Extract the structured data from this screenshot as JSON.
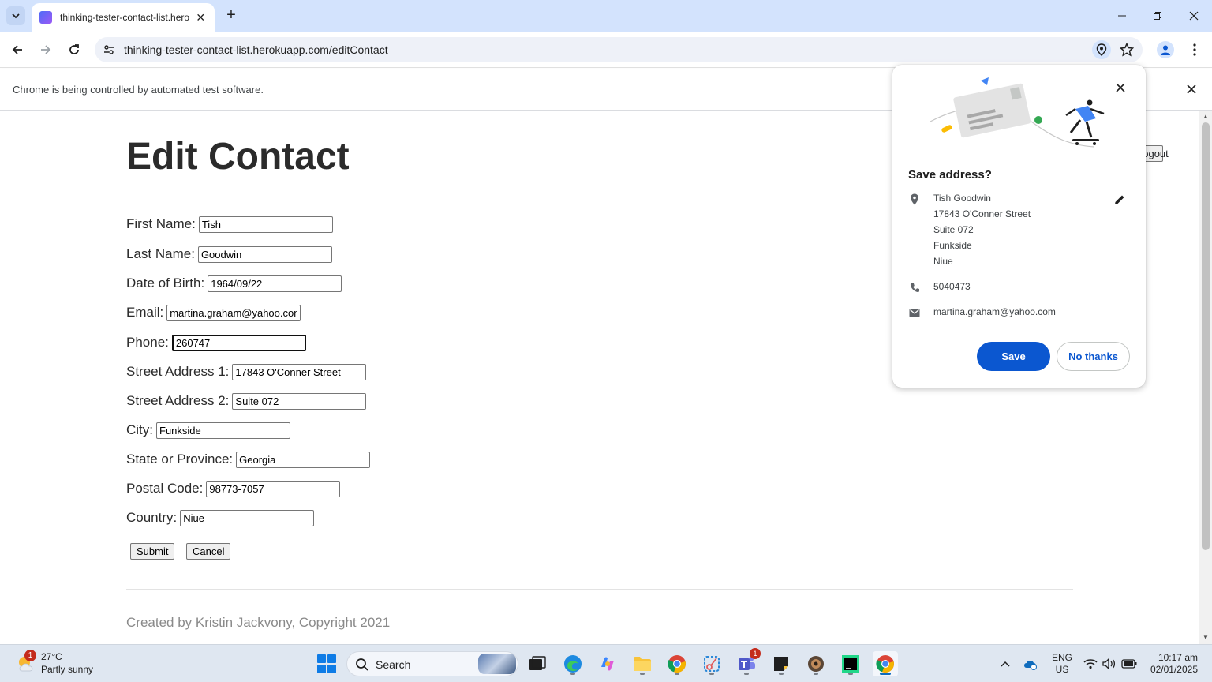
{
  "browser": {
    "tab_title": "thinking-tester-contact-list.herokuapp.com/editContact",
    "url": "thinking-tester-contact-list.herokuapp.com/editContact",
    "infobar_text": "Chrome is being controlled by automated test software."
  },
  "page": {
    "title": "Edit Contact",
    "logout_label": "Logout",
    "fields": [
      {
        "label": "First Name:",
        "value": "Tish"
      },
      {
        "label": "Last Name:",
        "value": "Goodwin"
      },
      {
        "label": "Date of Birth:",
        "value": "1964/09/22"
      },
      {
        "label": "Email:",
        "value": "martina.graham@yahoo.com"
      },
      {
        "label": "Phone:",
        "value": "260747"
      },
      {
        "label": "Street Address 1:",
        "value": "17843 O'Conner Street"
      },
      {
        "label": "Street Address 2:",
        "value": "Suite 072"
      },
      {
        "label": "City:",
        "value": "Funkside"
      },
      {
        "label": "State or Province:",
        "value": "Georgia"
      },
      {
        "label": "Postal Code:",
        "value": "98773-7057"
      },
      {
        "label": "Country:",
        "value": "Niue"
      }
    ],
    "submit_label": "Submit",
    "cancel_label": "Cancel",
    "footer": "Created by Kristin Jackvony, Copyright 2021"
  },
  "popup": {
    "title": "Save address?",
    "address_lines": [
      "Tish Goodwin",
      "17843 O'Conner Street",
      "Suite 072",
      "Funkside",
      "Niue"
    ],
    "phone": "5040473",
    "email": "martina.graham@yahoo.com",
    "save_label": "Save",
    "no_thanks_label": "No thanks",
    "accent_color": "#0b57d0"
  },
  "taskbar": {
    "weather_temp": "27°C",
    "weather_desc": "Partly sunny",
    "weather_badge": "1",
    "search_label": "Search",
    "teams_badge": "1",
    "lang_line1": "ENG",
    "lang_line2": "US",
    "time": "10:17 am",
    "date": "02/01/2025"
  }
}
